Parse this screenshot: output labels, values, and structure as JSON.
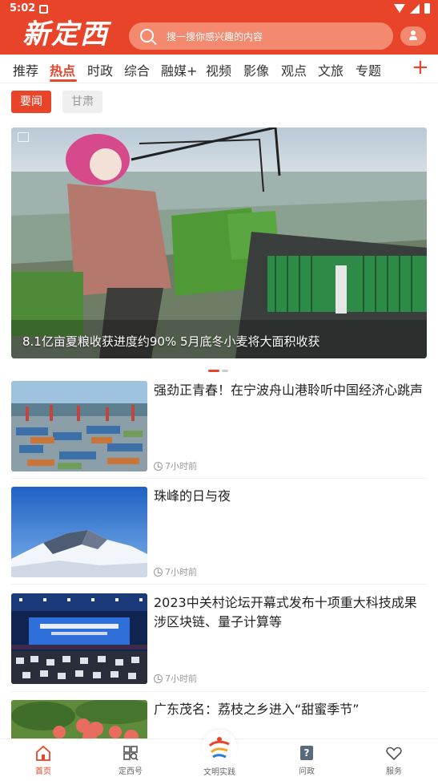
{
  "status_bar": {
    "time": "5:02"
  },
  "header": {
    "logo_text": "新定西",
    "search_placeholder": "搜一搜你感兴趣的内容"
  },
  "channels": {
    "items": [
      "推荐",
      "热点",
      "时政",
      "综合",
      "融媒+",
      "视频",
      "影像",
      "观点",
      "文旅",
      "专题"
    ],
    "active": "热点",
    "add_label": "+"
  },
  "sub_tabs": {
    "items": [
      "要闻",
      "甘肃"
    ],
    "active": "要闻"
  },
  "banner": {
    "caption": "8.1亿亩夏粮收获进度约90% 5月底冬小麦将大面积收获",
    "slide_index": 1,
    "slide_count": 2
  },
  "news": [
    {
      "title": "强劲正青春！在宁波舟山港聆听中国经济心跳声",
      "time": "7小时前",
      "thumb": "port"
    },
    {
      "title": "珠峰的日与夜",
      "time": "7小时前",
      "thumb": "everest"
    },
    {
      "title": "2023中关村论坛开幕式发布十项重大科技成果 涉区块链、量子计算等",
      "time": "7小时前",
      "thumb": "forum"
    },
    {
      "title": "广东茂名：荔枝之乡进入“甜蜜季节”",
      "time": "",
      "thumb": "lychee"
    }
  ],
  "bottom_nav": {
    "items": [
      {
        "label": "首页",
        "icon": "home-icon",
        "active": true
      },
      {
        "label": "定西号",
        "icon": "grid-search-icon",
        "active": false
      },
      {
        "label": "文明实践",
        "icon": "civilization-logo-icon",
        "active": false
      },
      {
        "label": "问政",
        "icon": "question-icon",
        "active": false
      },
      {
        "label": "服务",
        "icon": "heart-icon",
        "active": false
      }
    ]
  },
  "colors": {
    "brand": "#e8442a",
    "search_bg": "#f38a70"
  }
}
